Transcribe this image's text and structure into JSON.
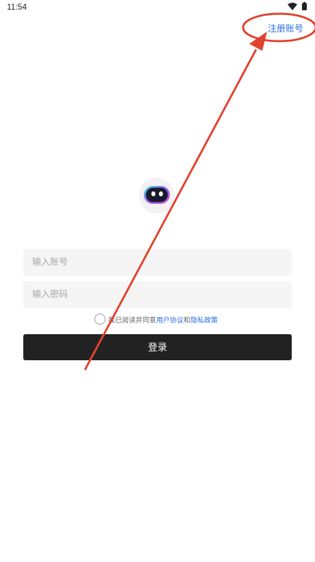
{
  "status_bar": {
    "time": "11:54",
    "wifi_icon": "wifi-icon",
    "battery_icon": "battery-icon"
  },
  "header": {
    "register_label": "注册账号"
  },
  "avatar": {
    "icon": "robot-avatar-icon"
  },
  "form": {
    "account_placeholder": "输入账号",
    "account_value": "",
    "password_placeholder": "输入密码",
    "password_value": "",
    "agree_prefix": "我已阅读并同意",
    "user_agreement": "用户协议",
    "and_text": "和",
    "privacy_policy": "隐私政策",
    "login_label": "登录"
  },
  "colors": {
    "link": "#2b6fe0",
    "button_bg": "#222222",
    "input_bg": "#f5f5f5",
    "annotation": "#e0432f"
  }
}
